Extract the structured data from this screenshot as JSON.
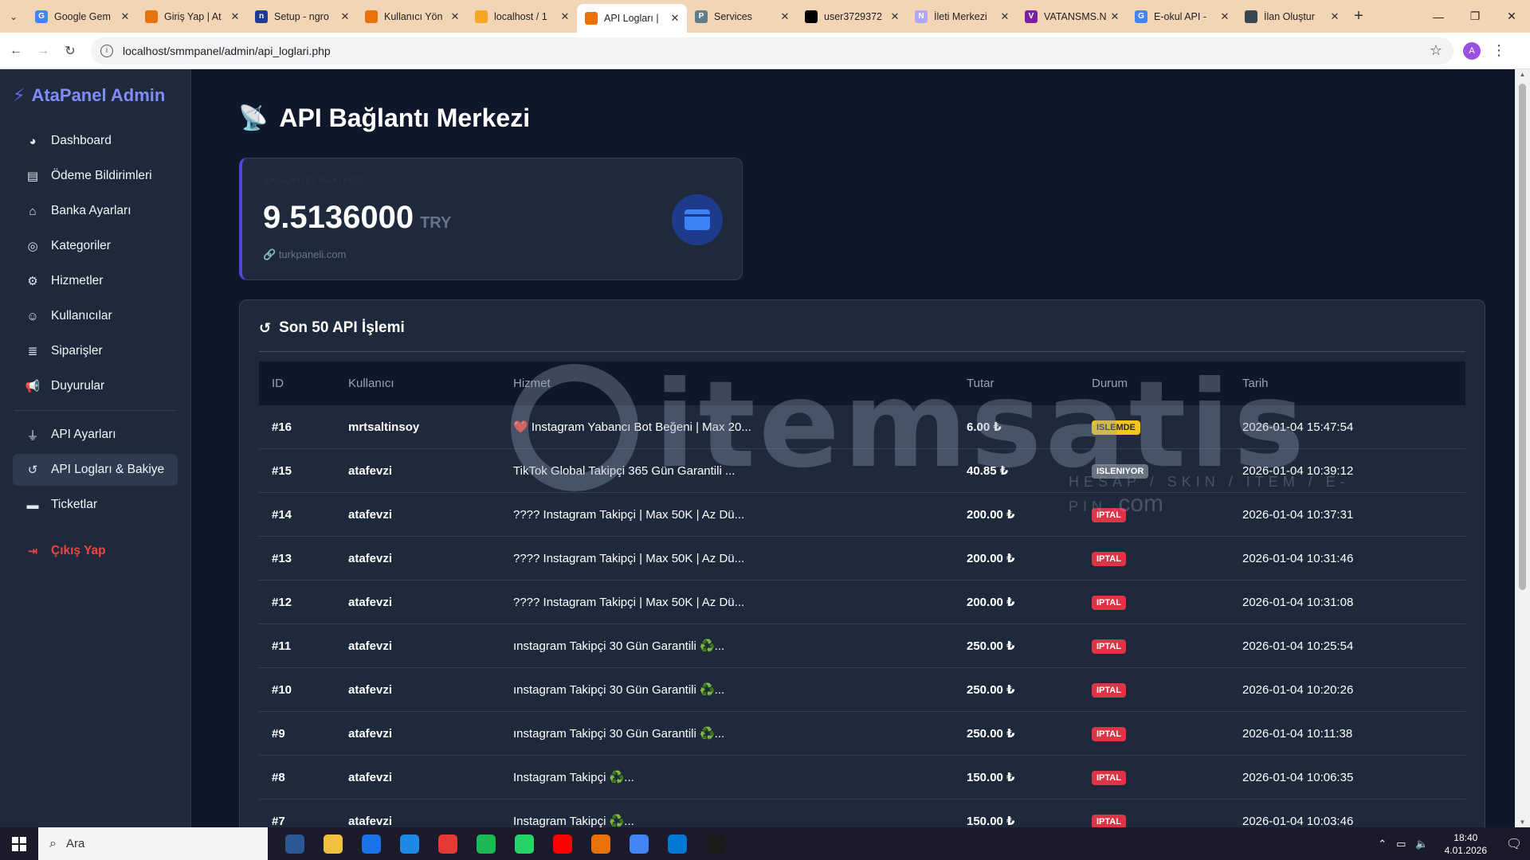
{
  "browser": {
    "tabs": [
      {
        "title": "Google Gem",
        "fav": "G",
        "color": "#4285f4"
      },
      {
        "title": "Giriş Yap | At",
        "fav": "",
        "color": "#e8710a"
      },
      {
        "title": "Setup - ngro",
        "fav": "n",
        "color": "#1f3b8f"
      },
      {
        "title": "Kullanıcı Yön",
        "fav": "",
        "color": "#e8710a"
      },
      {
        "title": "localhost / 1",
        "fav": "",
        "color": "#f5a623"
      },
      {
        "title": "API Logları |",
        "fav": "",
        "color": "#e8710a",
        "active": true
      },
      {
        "title": "Services",
        "fav": "P",
        "color": "#607d8b"
      },
      {
        "title": "user3729372",
        "fav": "",
        "color": "#000000"
      },
      {
        "title": "İleti Merkezi",
        "fav": "N",
        "color": "#b0a8ff"
      },
      {
        "title": "VATANSMS.N",
        "fav": "V",
        "color": "#7b1fa2"
      },
      {
        "title": "E-okul API -",
        "fav": "G",
        "color": "#4285f4"
      },
      {
        "title": "İlan Oluştur",
        "fav": "",
        "color": "#37474f"
      }
    ],
    "url": "localhost/smmpanel/admin/api_loglari.php",
    "profile_initial": "A"
  },
  "sidebar": {
    "brand": "AtaPanel Admin",
    "items": [
      {
        "label": "Dashboard",
        "icon": "◕"
      },
      {
        "label": "Ödeme Bildirimleri",
        "icon": "▤"
      },
      {
        "label": "Banka Ayarları",
        "icon": "⌂"
      },
      {
        "label": "Kategoriler",
        "icon": "◎"
      },
      {
        "label": "Hizmetler",
        "icon": "⚙"
      },
      {
        "label": "Kullanıcılar",
        "icon": "☺"
      },
      {
        "label": "Siparişler",
        "icon": "≣"
      },
      {
        "label": "Duyurular",
        "icon": "📢"
      },
      {
        "label": "API Ayarları",
        "icon": "⏚"
      },
      {
        "label": "API Logları & Bakiye",
        "icon": "↺"
      },
      {
        "label": "Ticketlar",
        "icon": "▬"
      }
    ],
    "logout": "Çıkış Yap"
  },
  "page": {
    "title": "API Bağlantı Merkezi"
  },
  "balance": {
    "label": "SAĞLAYICI BAKİYESİ",
    "amount": "9.5136000",
    "currency": "TRY",
    "source": "turkpaneli.com"
  },
  "table": {
    "heading": "Son 50 API İşlemi",
    "columns": [
      "ID",
      "Kullanıcı",
      "Hizmet",
      "Tutar",
      "Durum",
      "Tarih"
    ],
    "rows": [
      {
        "id": "#16",
        "user": "mrtsaltinsoy",
        "service": "❤️ Instagram Yabancı Bot Beğeni | Max 20...",
        "amount": "6.00 ₺",
        "status": "ISLEMDE",
        "status_type": "islemde",
        "date": "2026-01-04 15:47:54"
      },
      {
        "id": "#15",
        "user": "atafevzi",
        "service": "TikTok Global Takipçi 365 Gün Garantili ...",
        "amount": "40.85 ₺",
        "status": "ISLENIYOR",
        "status_type": "isleniyor",
        "date": "2026-01-04 10:39:12"
      },
      {
        "id": "#14",
        "user": "atafevzi",
        "service": "???? Instagram Takipçi | Max 50K | Az Dü...",
        "amount": "200.00 ₺",
        "status": "IPTAL",
        "status_type": "iptal",
        "date": "2026-01-04 10:37:31"
      },
      {
        "id": "#13",
        "user": "atafevzi",
        "service": "???? Instagram Takipçi | Max 50K | Az Dü...",
        "amount": "200.00 ₺",
        "status": "IPTAL",
        "status_type": "iptal",
        "date": "2026-01-04 10:31:46"
      },
      {
        "id": "#12",
        "user": "atafevzi",
        "service": "???? Instagram Takipçi | Max 50K | Az Dü...",
        "amount": "200.00 ₺",
        "status": "IPTAL",
        "status_type": "iptal",
        "date": "2026-01-04 10:31:08"
      },
      {
        "id": "#11",
        "user": "atafevzi",
        "service": "ınstagram Takipçi 30 Gün Garantili ♻️...",
        "amount": "250.00 ₺",
        "status": "IPTAL",
        "status_type": "iptal",
        "date": "2026-01-04 10:25:54"
      },
      {
        "id": "#10",
        "user": "atafevzi",
        "service": "ınstagram Takipçi 30 Gün Garantili ♻️...",
        "amount": "250.00 ₺",
        "status": "IPTAL",
        "status_type": "iptal",
        "date": "2026-01-04 10:20:26"
      },
      {
        "id": "#9",
        "user": "atafevzi",
        "service": "ınstagram Takipçi 30 Gün Garantili ♻️...",
        "amount": "250.00 ₺",
        "status": "IPTAL",
        "status_type": "iptal",
        "date": "2026-01-04 10:11:38"
      },
      {
        "id": "#8",
        "user": "atafevzi",
        "service": "Instagram Takipçi ♻️...",
        "amount": "150.00 ₺",
        "status": "IPTAL",
        "status_type": "iptal",
        "date": "2026-01-04 10:06:35"
      },
      {
        "id": "#7",
        "user": "atafevzi",
        "service": "Instagram Takipçi ♻️...",
        "amount": "150.00 ₺",
        "status": "IPTAL",
        "status_type": "iptal",
        "date": "2026-01-04 10:03:46"
      }
    ]
  },
  "watermark": {
    "text": "itemsatis",
    "sub": "HESAP / SKIN / ITEM / E-PIN",
    "suffix": ".com"
  },
  "taskbar": {
    "search_placeholder": "Ara",
    "time": "18:40",
    "date": "4.01.2026",
    "apps": [
      "#2b5797",
      "#f0c040",
      "#1a73e8",
      "#1e88e5",
      "#e53935",
      "#1db954",
      "#25d366",
      "#ff0000",
      "#e8710a",
      "#4285f4",
      "#0078d4",
      "#1a1a1a"
    ]
  }
}
